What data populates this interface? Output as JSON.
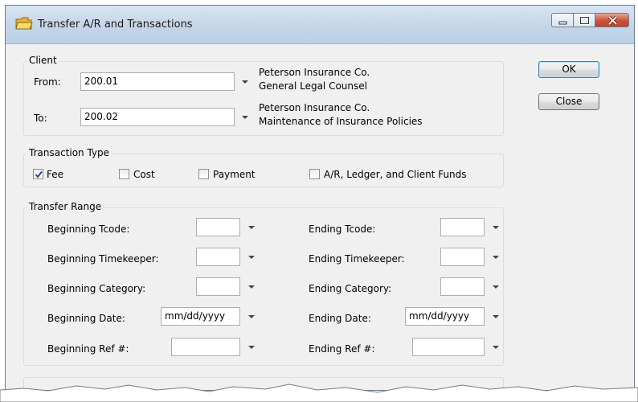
{
  "window": {
    "title": "Transfer A/R and Transactions"
  },
  "client": {
    "group_label": "Client",
    "from_label": "From:",
    "from_value": "200.01",
    "from_desc_line1": "Peterson Insurance Co.",
    "from_desc_line2": "General Legal Counsel",
    "to_label": "To:",
    "to_value": "200.02",
    "to_desc_line1": "Peterson Insurance Co.",
    "to_desc_line2": "Maintenance of Insurance Policies"
  },
  "transaction_type": {
    "group_label": "Transaction Type",
    "options": [
      {
        "label": "Fee",
        "checked": true
      },
      {
        "label": "Cost",
        "checked": false
      },
      {
        "label": "Payment",
        "checked": false
      },
      {
        "label": "A/R,  Ledger, and Client Funds",
        "checked": false
      }
    ]
  },
  "transfer_range": {
    "group_label": "Transfer Range",
    "beginning_tcode_label": "Beginning Tcode:",
    "beginning_timekeeper_label": "Beginning Timekeeper:",
    "beginning_category_label": "Beginning Category:",
    "beginning_date_label": "Beginning Date:",
    "beginning_date_value": "mm/dd/yyyy",
    "beginning_ref_label": "Beginning Ref #:",
    "ending_tcode_label": "Ending Tcode:",
    "ending_timekeeper_label": "Ending Timekeeper:",
    "ending_category_label": "Ending Category:",
    "ending_date_label": "Ending Date:",
    "ending_date_value": "mm/dd/yyyy",
    "ending_ref_label": "Ending Ref #:"
  },
  "buttons": {
    "ok": "OK",
    "close": "Close"
  }
}
